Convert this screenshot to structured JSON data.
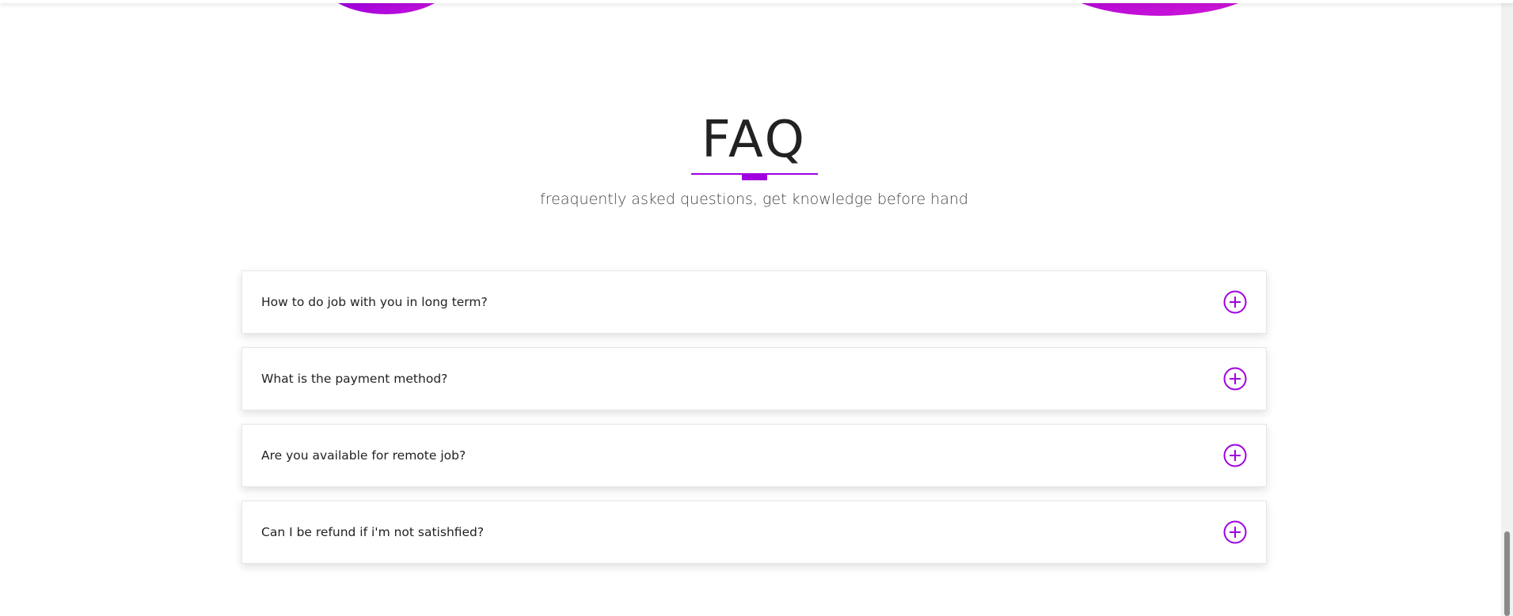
{
  "colors": {
    "accent": "#a000e0",
    "blob_left": "#b10ddf",
    "blob_right": "#c815d7",
    "title": "#222222",
    "text": "#222222",
    "subtitle": "#444444"
  },
  "faq": {
    "title": "FAQ",
    "subtitle": "freaquently asked questions, get knowledge before hand",
    "items": [
      {
        "question": "How to do job with you in long term?",
        "toggle_icon": "plus-circle-icon"
      },
      {
        "question": "What is the payment method?",
        "toggle_icon": "plus-circle-icon"
      },
      {
        "question": "Are you available for remote job?",
        "toggle_icon": "plus-circle-icon"
      },
      {
        "question": "Can I be refund if i'm not satishfied?",
        "toggle_icon": "plus-circle-icon"
      }
    ]
  }
}
